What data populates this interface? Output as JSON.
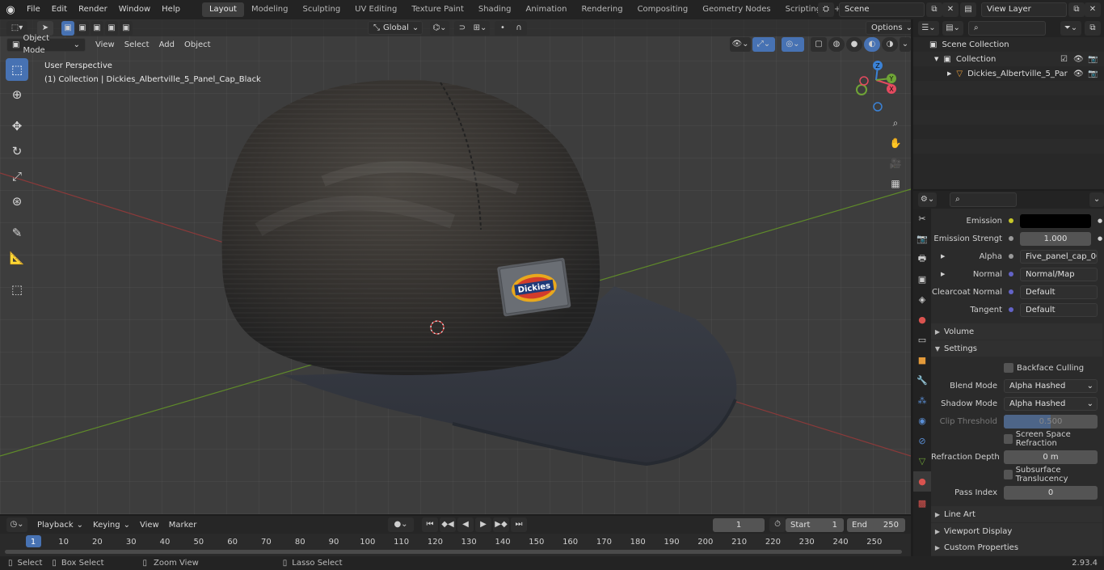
{
  "topbar": {
    "menus": [
      "File",
      "Edit",
      "Render",
      "Window",
      "Help"
    ],
    "workspaces": [
      "Layout",
      "Modeling",
      "Sculpting",
      "UV Editing",
      "Texture Paint",
      "Shading",
      "Animation",
      "Rendering",
      "Compositing",
      "Geometry Nodes",
      "Scripting"
    ],
    "active_workspace": "Layout",
    "scene": "Scene",
    "view_layer": "View Layer"
  },
  "viewport": {
    "mode": "Object Mode",
    "menus": [
      "View",
      "Select",
      "Add",
      "Object"
    ],
    "orientation": "Global",
    "options": "Options",
    "perspective_label": "User Perspective",
    "collection_label": "(1) Collection | Dickies_Albertville_5_Panel_Cap_Black",
    "brand_text": "Dickies"
  },
  "gizmo": {
    "x": "X",
    "y": "Y",
    "z": "Z"
  },
  "timeline": {
    "menus": [
      "Playback",
      "Keying",
      "View",
      "Marker"
    ],
    "current_frame": "1",
    "start_label": "Start",
    "start": "1",
    "end_label": "End",
    "end": "250",
    "ruler": [
      "1",
      "10",
      "20",
      "30",
      "40",
      "50",
      "60",
      "70",
      "80",
      "90",
      "100",
      "110",
      "120",
      "130",
      "140",
      "150",
      "160",
      "170",
      "180",
      "190",
      "200",
      "210",
      "220",
      "230",
      "240",
      "250"
    ]
  },
  "statusbar": {
    "select": "Select",
    "box_select": "Box Select",
    "zoom_view": "Zoom View",
    "lasso_select": "Lasso Select",
    "version": "2.93.4"
  },
  "outliner": {
    "scene_collection": "Scene Collection",
    "collection": "Collection",
    "object": "Dickies_Albertville_5_Par"
  },
  "properties": {
    "emission_label": "Emission",
    "emission_strength_label": "Emission Strengt",
    "emission_strength": "1.000",
    "alpha_label": "Alpha",
    "alpha_value": "Five_panel_cap_003...",
    "normal_label": "Normal",
    "normal_value": "Normal/Map",
    "clearcoat_label": "Clearcoat Normal",
    "clearcoat_value": "Default",
    "tangent_label": "Tangent",
    "tangent_value": "Default",
    "volume": "Volume",
    "settings": "Settings",
    "backface": "Backface Culling",
    "blend_mode_label": "Blend Mode",
    "blend_mode": "Alpha Hashed",
    "shadow_mode_label": "Shadow Mode",
    "shadow_mode": "Alpha Hashed",
    "clip_label": "Clip Threshold",
    "clip_value": "0.500",
    "clip_fraction": 0.5,
    "ssr": "Screen Space Refraction",
    "refraction_depth_label": "Refraction Depth",
    "refraction_depth": "0 m",
    "sss": "Subsurface Translucency",
    "pass_index_label": "Pass Index",
    "pass_index": "0",
    "line_art": "Line Art",
    "viewport_display": "Viewport Display",
    "custom_properties": "Custom Properties"
  },
  "colors": {
    "accent": "#4772b3",
    "x_axis": "#e44a5f",
    "y_axis": "#6fa436",
    "z_axis": "#3b82d6"
  }
}
